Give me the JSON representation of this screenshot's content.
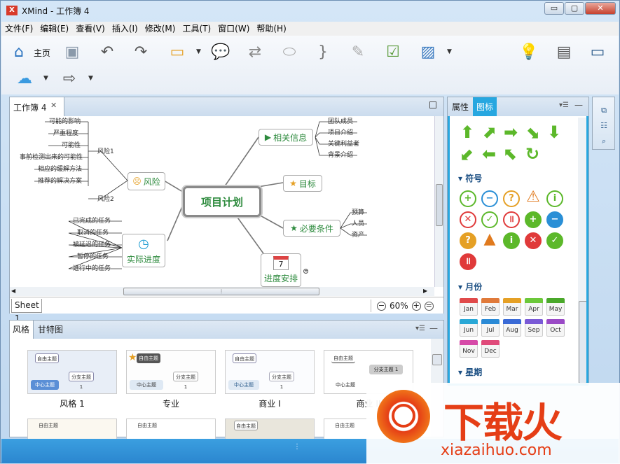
{
  "window": {
    "title": "XMind - 工作簿 4",
    "logo": "X",
    "minimize": "▭",
    "maximize": "▢",
    "close": "✕"
  },
  "menu": [
    "文件(F)",
    "编辑(E)",
    "查看(V)",
    "插入(I)",
    "修改(M)",
    "工具(T)",
    "窗口(W)",
    "帮助(H)"
  ],
  "toolbar": {
    "home_label": "主页"
  },
  "editor": {
    "tab_label": "工作簿 4",
    "sheet_label": "Sheet 1",
    "zoom": "60%",
    "map": {
      "central": "项目计划",
      "topics": {
        "risk": "风险",
        "info": "相关信息",
        "goal": "目标",
        "req": "必要条件",
        "progress": "实际进度",
        "schedule": "进度安排"
      },
      "risk_groups": [
        "风险1",
        "风险2"
      ],
      "risk1_items": [
        "可能的影响",
        "严重程度",
        "可能性",
        "事前检测出来的可能性",
        "相应的缓解方法",
        "推荐的解决方案"
      ],
      "info_items": [
        "团队成员",
        "项目介绍",
        "关键利益者",
        "背景介绍"
      ],
      "req_items": [
        "预算",
        "人员",
        "资产"
      ],
      "progress_items": [
        "已完成的任务",
        "取消的任务",
        "被延迟的任务",
        "暂停的任务",
        "进行中的任务"
      ],
      "calendar_day": "7"
    }
  },
  "bottom_panel": {
    "tabs": [
      "风格",
      "甘特图"
    ],
    "styles": [
      "风格 1",
      "专业",
      "商业 I",
      "商业 II"
    ],
    "thumb_texts": {
      "topic": "自由主题",
      "central": "中心主题",
      "branch": "分支主题 1",
      "sub": "子主题 1",
      "label": "标签"
    }
  },
  "right_panel": {
    "tabs": [
      "属性",
      "图标"
    ],
    "sections": [
      "符号",
      "月份",
      "星期"
    ],
    "months": [
      "Jan",
      "Feb",
      "Mar",
      "Apr",
      "May",
      "Jun",
      "Jul",
      "Aug",
      "Sep",
      "Oct",
      "Nov",
      "Dec"
    ]
  },
  "colors": {
    "accent": "#27a7e0",
    "green": "#2e8b3e",
    "arrow_green": "#5cb82a",
    "status_bar": "#2b86cf",
    "watermark": "#e53e16"
  },
  "watermark": {
    "title": "下载火",
    "url": "xiazaihuo.com"
  }
}
